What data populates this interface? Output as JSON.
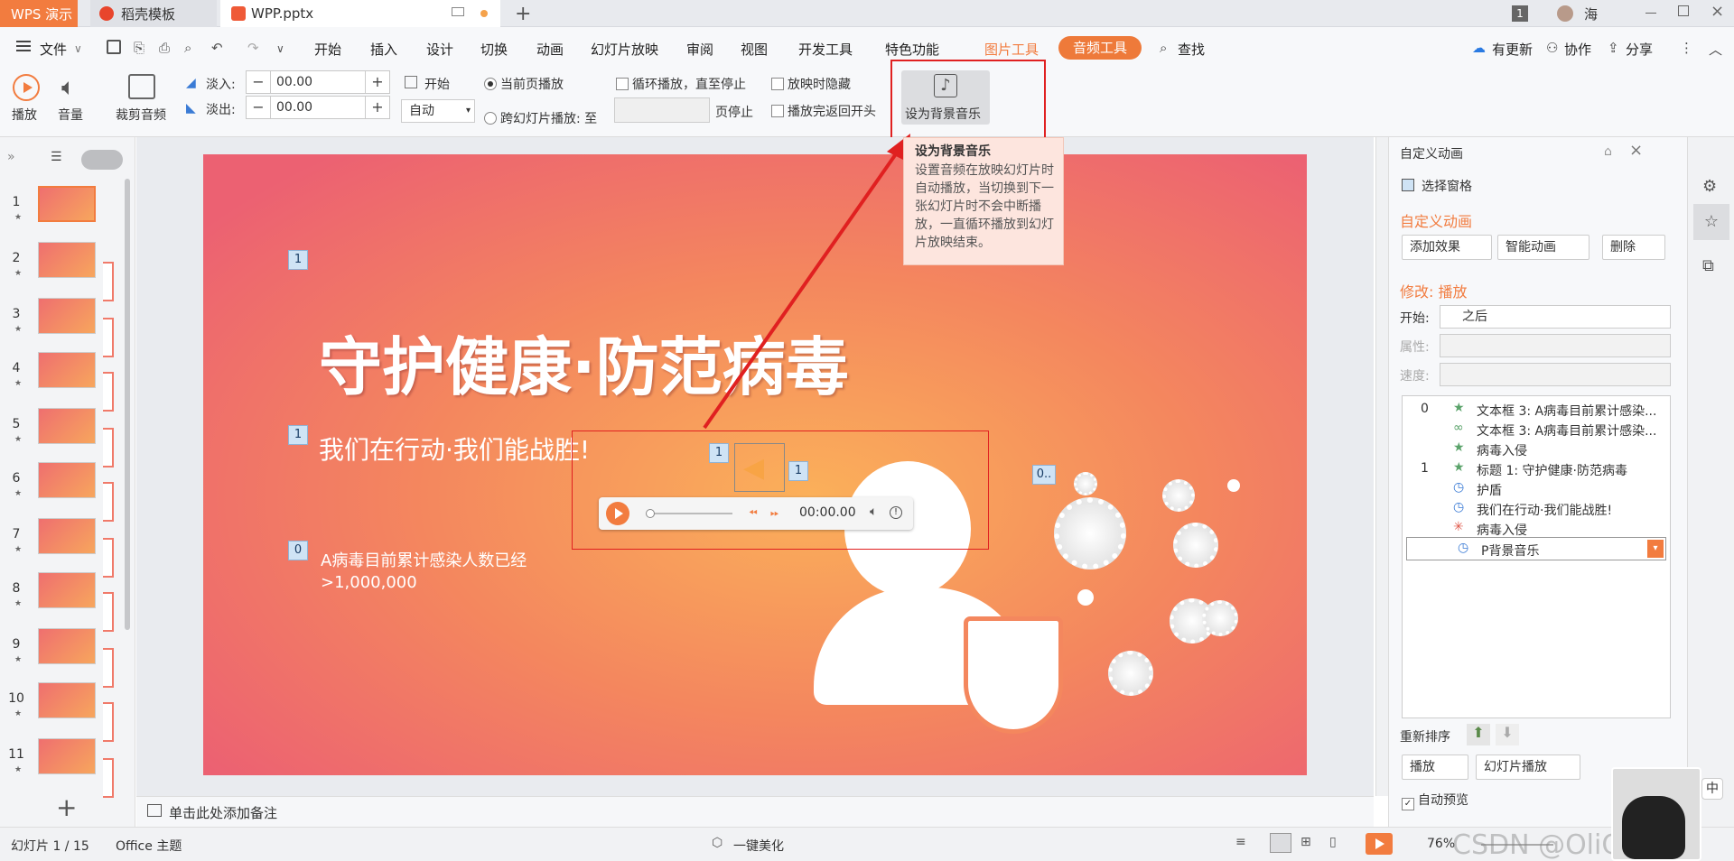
{
  "tabs": {
    "app": "WPS 演示",
    "template": "稻壳模板",
    "file": "WPP.pptx",
    "user": "海"
  },
  "menu": {
    "file": "文件",
    "items": [
      "开始",
      "插入",
      "设计",
      "切换",
      "动画",
      "幻灯片放映",
      "审阅",
      "视图",
      "开发工具",
      "特色功能"
    ],
    "picture_tools": "图片工具",
    "audio_tools": "音频工具",
    "search": "查找",
    "update": "有更新",
    "collab": "协作",
    "share": "分享"
  },
  "ribbon": {
    "play": "播放",
    "volume": "音量",
    "trim": "裁剪音频",
    "fade_in": "淡入:",
    "fade_out": "淡出:",
    "fade_in_val": "00.00",
    "fade_out_val": "00.00",
    "start": "开始",
    "start_val": "自动",
    "current_page": "当前页播放",
    "cross_slide": "跨幻灯片播放: 至",
    "page_stop": "页停止",
    "loop": "循环播放，直至停止",
    "hide": "放映时隐藏",
    "rewind": "播放完返回开头",
    "bg_music": "设为背景音乐"
  },
  "tooltip": {
    "title": "设为背景音乐",
    "body": "设置音频在放映幻灯片时自动播放，当切换到下一张幻灯片时不会中断播放，一直循环播放到幻灯片放映结束。"
  },
  "slides": {
    "count_labels": [
      "1",
      "2",
      "3",
      "4",
      "5",
      "6",
      "7",
      "8",
      "9",
      "10",
      "11"
    ],
    "add": "+"
  },
  "slide": {
    "title": "守护健康·防范病毒",
    "subtitle": "我们在行动·我们能战胜!",
    "text": "A病毒目前累计感染人数已经",
    "number": ">1,000,000",
    "markers": [
      "1",
      "1",
      "0",
      "1",
      "1",
      "0.."
    ],
    "time": "00:00.00"
  },
  "notes": "单击此处添加备注",
  "pane": {
    "header": "自定义动画",
    "select_pane": "选择窗格",
    "title": "自定义动画",
    "add_effect": "添加效果",
    "smart_anim": "智能动画",
    "delete": "删除",
    "modify": "修改: 播放",
    "start_label": "开始:",
    "start_val": "之后",
    "prop_label": "属性:",
    "speed_label": "速度:",
    "anims": [
      {
        "n": "0",
        "t": "文本框 3: A病毒目前累计感染..."
      },
      {
        "n": "",
        "t": "文本框 3: A病毒目前累计感染..."
      },
      {
        "n": "",
        "t": "病毒入侵"
      },
      {
        "n": "1",
        "t": "标题 1: 守护健康·防范病毒"
      },
      {
        "n": "",
        "t": "护盾"
      },
      {
        "n": "",
        "t": "我们在行动·我们能战胜!"
      },
      {
        "n": "",
        "t": "病毒入侵"
      },
      {
        "n": "",
        "t": "P背景音乐"
      }
    ],
    "reorder": "重新排序",
    "play": "播放",
    "slideshow": "幻灯片播放",
    "autopreview": "自动预览"
  },
  "status": {
    "slide": "幻灯片 1 / 15",
    "theme": "Office 主题",
    "beautify": "一键美化",
    "zoom": "76%",
    "watermark": "CSDN @OliCorrect",
    "ime": "中"
  },
  "colors": {
    "accent": "#f27c3f",
    "audio_tab": "#ee7a3a",
    "red": "#e02020"
  }
}
